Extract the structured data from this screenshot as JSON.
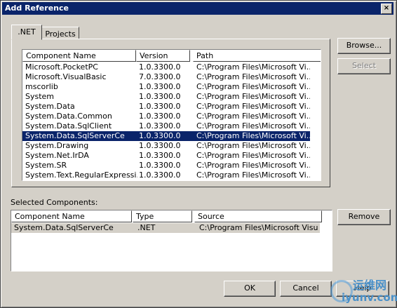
{
  "window": {
    "title": "Add Reference",
    "close_glyph": "×"
  },
  "tabs": [
    {
      "label": ".NET"
    },
    {
      "label": "Projects"
    }
  ],
  "components_list": {
    "columns": [
      "Component Name",
      "Version",
      "Path"
    ],
    "rows": [
      {
        "name": "Microsoft.PocketPC",
        "version": "1.0.3300.0",
        "path": "C:\\Program Files\\Microsoft Vi..."
      },
      {
        "name": "Microsoft.VisualBasic",
        "version": "7.0.3300.0",
        "path": "C:\\Program Files\\Microsoft Vi..."
      },
      {
        "name": "mscorlib",
        "version": "1.0.3300.0",
        "path": "C:\\Program Files\\Microsoft Vi..."
      },
      {
        "name": "System",
        "version": "1.0.3300.0",
        "path": "C:\\Program Files\\Microsoft Vi..."
      },
      {
        "name": "System.Data",
        "version": "1.0.3300.0",
        "path": "C:\\Program Files\\Microsoft Vi..."
      },
      {
        "name": "System.Data.Common",
        "version": "1.0.3300.0",
        "path": "C:\\Program Files\\Microsoft Vi..."
      },
      {
        "name": "System.Data.SqlClient",
        "version": "1.0.3300.0",
        "path": "C:\\Program Files\\Microsoft Vi..."
      },
      {
        "name": "System.Data.SqlServerCe",
        "version": "1.0.3300.0",
        "path": "C:\\Program Files\\Microsoft Vi..."
      },
      {
        "name": "System.Drawing",
        "version": "1.0.3300.0",
        "path": "C:\\Program Files\\Microsoft Vi..."
      },
      {
        "name": "System.Net.IrDA",
        "version": "1.0.3300.0",
        "path": "C:\\Program Files\\Microsoft Vi..."
      },
      {
        "name": "System.SR",
        "version": "1.0.3300.0",
        "path": "C:\\Program Files\\Microsoft Vi..."
      },
      {
        "name": "System.Text.RegularExpressi...",
        "version": "1.0.3300.0",
        "path": "C:\\Program Files\\Microsoft Vi..."
      }
    ],
    "selected_row": "System.Data.SqlServerCe"
  },
  "buttons": {
    "browse": "Browse...",
    "select": "Select",
    "remove": "Remove",
    "ok": "OK",
    "cancel": "Cancel",
    "help": "Help"
  },
  "selected_components": {
    "label": "Selected Components:",
    "columns": [
      "Component Name",
      "Type",
      "Source"
    ],
    "rows": [
      {
        "name": "System.Data.SqlServerCe",
        "type": ".NET",
        "source": "C:\\Program Files\\Microsoft Visu..."
      }
    ]
  },
  "watermark": {
    "text_cn": "运维网",
    "url": "iyunv.com"
  },
  "colors": {
    "face": "#d4d0c8",
    "title_bar": "#0a246a",
    "selection": "#0a246a"
  },
  "icons": {
    "scroll_up": "▲",
    "scroll_down": "▼"
  }
}
